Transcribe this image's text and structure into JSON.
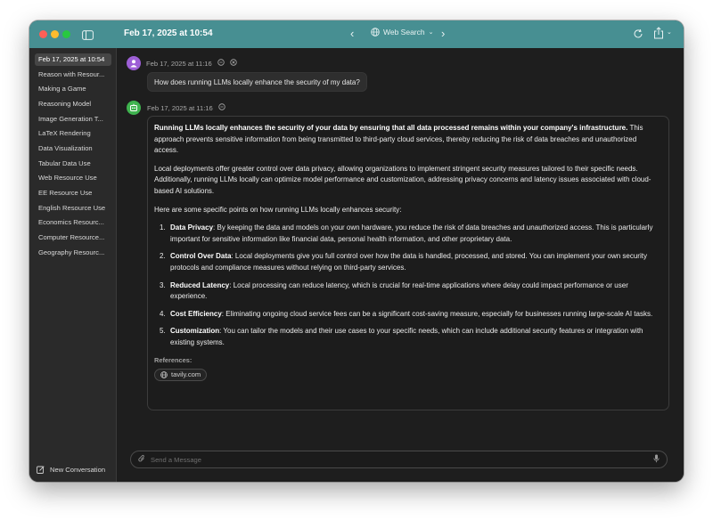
{
  "titlebar": {
    "title": "Feb 17, 2025 at 10:54",
    "web_search_label": "Web Search"
  },
  "sidebar": {
    "items": [
      {
        "label": "Feb 17, 2025 at 10:54",
        "active": true
      },
      {
        "label": "Reason with Resour..."
      },
      {
        "label": "Making a Game"
      },
      {
        "label": "Reasoning Model"
      },
      {
        "label": "Image Generation T..."
      },
      {
        "label": "LaTeX Rendering"
      },
      {
        "label": "Data Visualization"
      },
      {
        "label": "Tabular Data Use"
      },
      {
        "label": "Web Resource Use"
      },
      {
        "label": "EE Resource Use"
      },
      {
        "label": "English Resource Use"
      },
      {
        "label": "Economics Resourc..."
      },
      {
        "label": "Computer Resource..."
      },
      {
        "label": "Geography Resourc..."
      }
    ],
    "new_conversation": "New Conversation"
  },
  "conversation": {
    "user": {
      "timestamp": "Feb 17, 2025 at 11:16",
      "message": "How does running LLMs locally enhance the security of my data?"
    },
    "assistant": {
      "timestamp": "Feb 17, 2025 at 11:16",
      "para1_bold1": "Running LLMs locally enhances the security of your data by ensuring that all data processed remains within your company's infrastructure.",
      "para1_rest": " This approach prevents sensitive information from being transmitted to third-party cloud services, thereby reducing the risk of data breaches and unauthorized access.",
      "para2": "Local deployments offer greater control over data privacy, allowing organizations to implement stringent security measures tailored to their specific needs. Additionally, running LLMs locally can optimize model performance and customization, addressing privacy concerns and latency issues associated with cloud-based AI solutions.",
      "para3": "Here are some specific points on how running LLMs locally enhances security:",
      "points": [
        {
          "num": "1.",
          "title": "Data Privacy",
          "text": ": By keeping the data and models on your own hardware, you reduce the risk of data breaches and unauthorized access. This is particularly important for sensitive information like financial data, personal health information, and other proprietary data."
        },
        {
          "num": "2.",
          "title": "Control Over Data",
          "text": ": Local deployments give you full control over how the data is handled, processed, and stored. You can implement your own security protocols and compliance measures without relying on third-party services."
        },
        {
          "num": "3.",
          "title": "Reduced Latency",
          "text": ": Local processing can reduce latency, which is crucial for real-time applications where delay could impact performance or user experience."
        },
        {
          "num": "4.",
          "title": "Cost Efficiency",
          "text": ": Eliminating ongoing cloud service fees can be a significant cost-saving measure, especially for businesses running large-scale AI tasks."
        },
        {
          "num": "5.",
          "title": "Customization",
          "text": ": You can tailor the models and their use cases to your specific needs, which can include additional security features or integration with existing systems."
        }
      ],
      "references_label": "References:",
      "reference": "tavily.com"
    }
  },
  "input": {
    "placeholder": "Send a Message"
  },
  "colors": {
    "titlebar": "#478f92",
    "user_avatar": "#9d5fd6",
    "bot_avatar": "#3fb34f"
  }
}
